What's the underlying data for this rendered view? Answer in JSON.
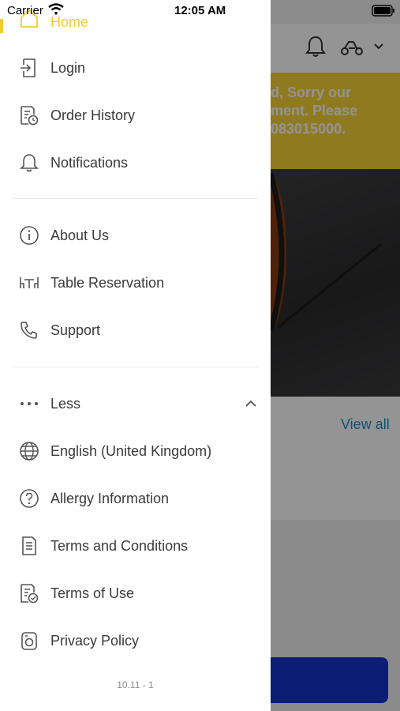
{
  "status_bar": {
    "carrier": "Carrier",
    "time": "12:05 AM"
  },
  "drawer": {
    "home_label": "Home",
    "items_group1": [
      {
        "label": "Login",
        "icon": "login-icon"
      },
      {
        "label": "Order History",
        "icon": "order-history-icon"
      },
      {
        "label": "Notifications",
        "icon": "bell-icon"
      }
    ],
    "items_group2": [
      {
        "label": "About Us",
        "icon": "info-icon"
      },
      {
        "label": "Table Reservation",
        "icon": "table-icon"
      },
      {
        "label": "Support",
        "icon": "phone-icon"
      }
    ],
    "less_label": "Less",
    "items_group3": [
      {
        "label": "English (United Kingdom)",
        "icon": "globe-icon"
      },
      {
        "label": "Allergy Information",
        "icon": "question-icon"
      },
      {
        "label": "Terms and Conditions",
        "icon": "document-icon"
      },
      {
        "label": "Terms of Use",
        "icon": "document-check-icon"
      },
      {
        "label": "Privacy Policy",
        "icon": "privacy-icon"
      }
    ],
    "version": "10.11 - 1"
  },
  "background": {
    "banner_text": "d, Sorry our\nment. Please\n083015000.",
    "view_all": "View all"
  },
  "colors": {
    "accent_yellow": "#f3cc2f",
    "link_blue": "#1a8fc7",
    "button_blue": "#1433c8"
  }
}
